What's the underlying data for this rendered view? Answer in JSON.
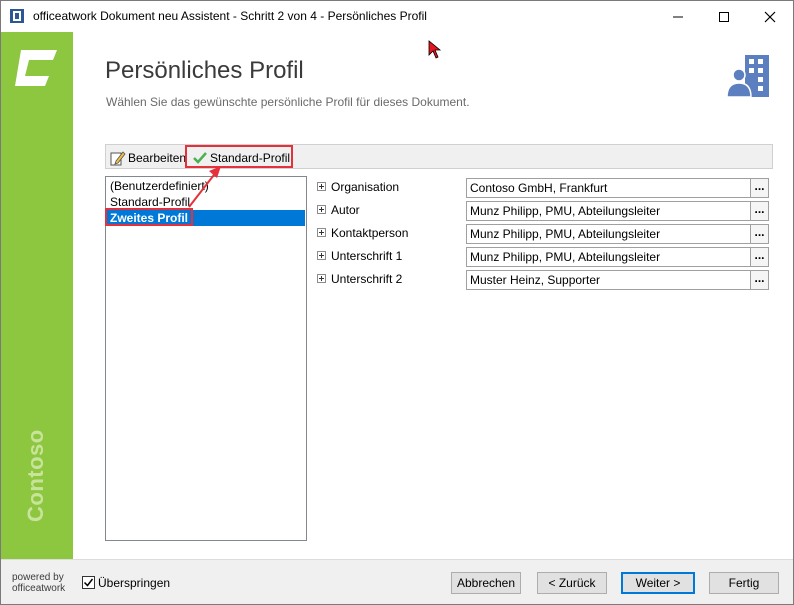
{
  "window": {
    "title": "officeatwork Dokument neu Assistent - Schritt 2 von 4 - Persönliches Profil"
  },
  "sidebar": {
    "brand_text": "Contoso"
  },
  "header": {
    "title": "Persönliches Profil",
    "subtitle": "Wählen Sie das gewünschte persönliche Profil für dieses Dokument."
  },
  "toolbar": {
    "edit_label": "Bearbeiten",
    "default_label": "Standard-Profil"
  },
  "profiles": [
    {
      "label": "(Benutzerdefiniert)",
      "selected": false
    },
    {
      "label": "Standard-Profil",
      "selected": false
    },
    {
      "label": "Zweites Profil",
      "selected": true
    }
  ],
  "properties": [
    {
      "label": "Organisation",
      "value": "Contoso GmbH, Frankfurt"
    },
    {
      "label": "Autor",
      "value": "Munz Philipp, PMU, Abteilungsleiter"
    },
    {
      "label": "Kontaktperson",
      "value": "Munz Philipp, PMU, Abteilungsleiter"
    },
    {
      "label": "Unterschrift 1",
      "value": "Munz Philipp, PMU, Abteilungsleiter"
    },
    {
      "label": "Unterschrift 2",
      "value": "Muster Heinz, Supporter"
    }
  ],
  "ellipsis": "...",
  "footer": {
    "powered_line1": "powered by",
    "powered_line2": "officeatwork",
    "skip_label": "Überspringen",
    "skip_checked": true,
    "cancel_label": "Abbrechen",
    "back_label": "< Zurück",
    "next_label": "Weiter >",
    "finish_label": "Fertig"
  },
  "colors": {
    "sidebar_green": "#8dc63f",
    "selection_blue": "#0078d7",
    "highlight_red": "#e3323c",
    "company_icon_blue": "#5b7fbf"
  }
}
